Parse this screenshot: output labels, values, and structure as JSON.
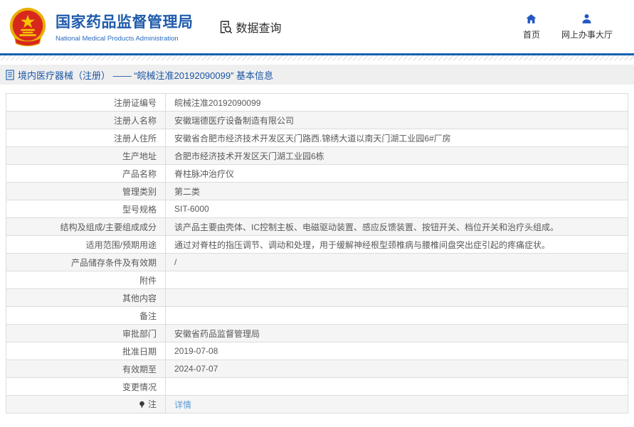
{
  "header": {
    "title": "国家药品监督管理局",
    "subtitle": "National Medical Products Administration",
    "section_label": "数据查询",
    "nav": [
      {
        "label": "首页",
        "icon": "home-icon"
      },
      {
        "label": "网上办事大厅",
        "icon": "person-icon"
      }
    ]
  },
  "breadcrumb": {
    "text": "境内医疗器械（注册） —— “皖械注准20192090099” 基本信息"
  },
  "table": {
    "rows": [
      {
        "label": "注册证编号",
        "value": "皖械注准20192090099"
      },
      {
        "label": "注册人名称",
        "value": "安徽瑞德医疗设备制造有限公司"
      },
      {
        "label": "注册人住所",
        "value": "安徽省合肥市经济技术开发区天门路西.锦绣大道以南天门湖工业园6#厂房"
      },
      {
        "label": "生产地址",
        "value": "合肥市经济技术开发区天门湖工业园6栋"
      },
      {
        "label": "产品名称",
        "value": "脊柱脉冲治疗仪"
      },
      {
        "label": "管理类别",
        "value": "第二类"
      },
      {
        "label": "型号规格",
        "value": "SIT-6000"
      },
      {
        "label": "结构及组成/主要组成成分",
        "value": "该产品主要由壳体、IC控制主板、电磁驱动装置、感应反馈装置、按钮开关、档位开关和治疗头组成。"
      },
      {
        "label": "适用范围/预期用途",
        "value": "通过对脊柱的指压调节、调动和处理，用于缓解神经根型颈椎病与腰椎间盘突出症引起的疼痛症状。"
      },
      {
        "label": "产品储存条件及有效期",
        "value": "/"
      },
      {
        "label": "附件",
        "value": ""
      },
      {
        "label": "其他内容",
        "value": ""
      },
      {
        "label": "备注",
        "value": ""
      },
      {
        "label": "审批部门",
        "value": "安徽省药品监督管理局"
      },
      {
        "label": "批准日期",
        "value": "2019-07-08"
      },
      {
        "label": "有效期至",
        "value": "2024-07-07"
      },
      {
        "label": "变更情况",
        "value": ""
      },
      {
        "label": "注",
        "value": "详情",
        "link": true,
        "icon": "note-icon"
      }
    ]
  },
  "colors": {
    "title_blue": "#1f5bab",
    "line_blue": "#1261b2",
    "icon_blue": "#2257c4",
    "breadcrumb_blue": "#1a55a3",
    "link_blue": "#5b9bd5",
    "emblem_red": "#d8281e",
    "emblem_gold": "#f0b400",
    "row_alt_bg": "#f5f5f5",
    "border_gray": "#dcdcdc",
    "text_gray": "#595959"
  }
}
